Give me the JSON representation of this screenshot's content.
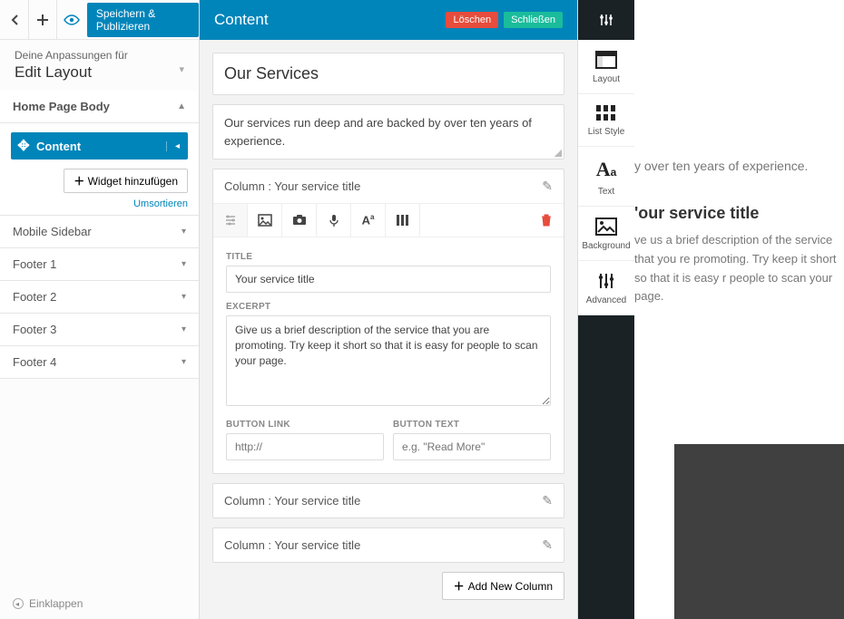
{
  "top": {
    "save_publish": "Speichern & Publizieren"
  },
  "crumb": "Deine Anpassungen für",
  "edit_title": "Edit Layout",
  "sidebar": {
    "active_section": "Home Page Body",
    "content_label": "Content",
    "add_widget": "Widget hinzufügen",
    "reorder": "Umsortieren",
    "sections": [
      "Mobile Sidebar",
      "Footer 1",
      "Footer 2",
      "Footer 3",
      "Footer 4"
    ],
    "collapse": "Einklappen"
  },
  "center": {
    "header_title": "Content",
    "delete": "Löschen",
    "close": "Schließen",
    "title_value": "Our Services",
    "desc_value": "Our services run deep and are backed by over ten years of experience.",
    "column1_header": "Column : Your service title",
    "title_lbl": "TITLE",
    "title_field": "Your service title",
    "excerpt_lbl": "EXCERPT",
    "excerpt_field": "Give us a brief description of the service that you are promoting. Try keep it short so that it is easy for people to scan your page.",
    "button_link_lbl": "BUTTON LINK",
    "button_link_placeholder": "http://",
    "button_text_lbl": "BUTTON TEXT",
    "button_text_placeholder": "e.g. \"Read More\"",
    "column2_header": "Column : Your service title",
    "column3_header": "Column : Your service title",
    "add_column": "Add New Column"
  },
  "tabs": {
    "layout": "Layout",
    "list_style": "List Style",
    "text": "Text",
    "background": "Background",
    "advanced": "Advanced"
  },
  "preview": {
    "line": "y over ten years of experience.",
    "htitle": "'our service title",
    "desc": "ve us a brief description of the service that you\nre promoting. Try keep it short so that it is easy\nr people to scan your page."
  }
}
